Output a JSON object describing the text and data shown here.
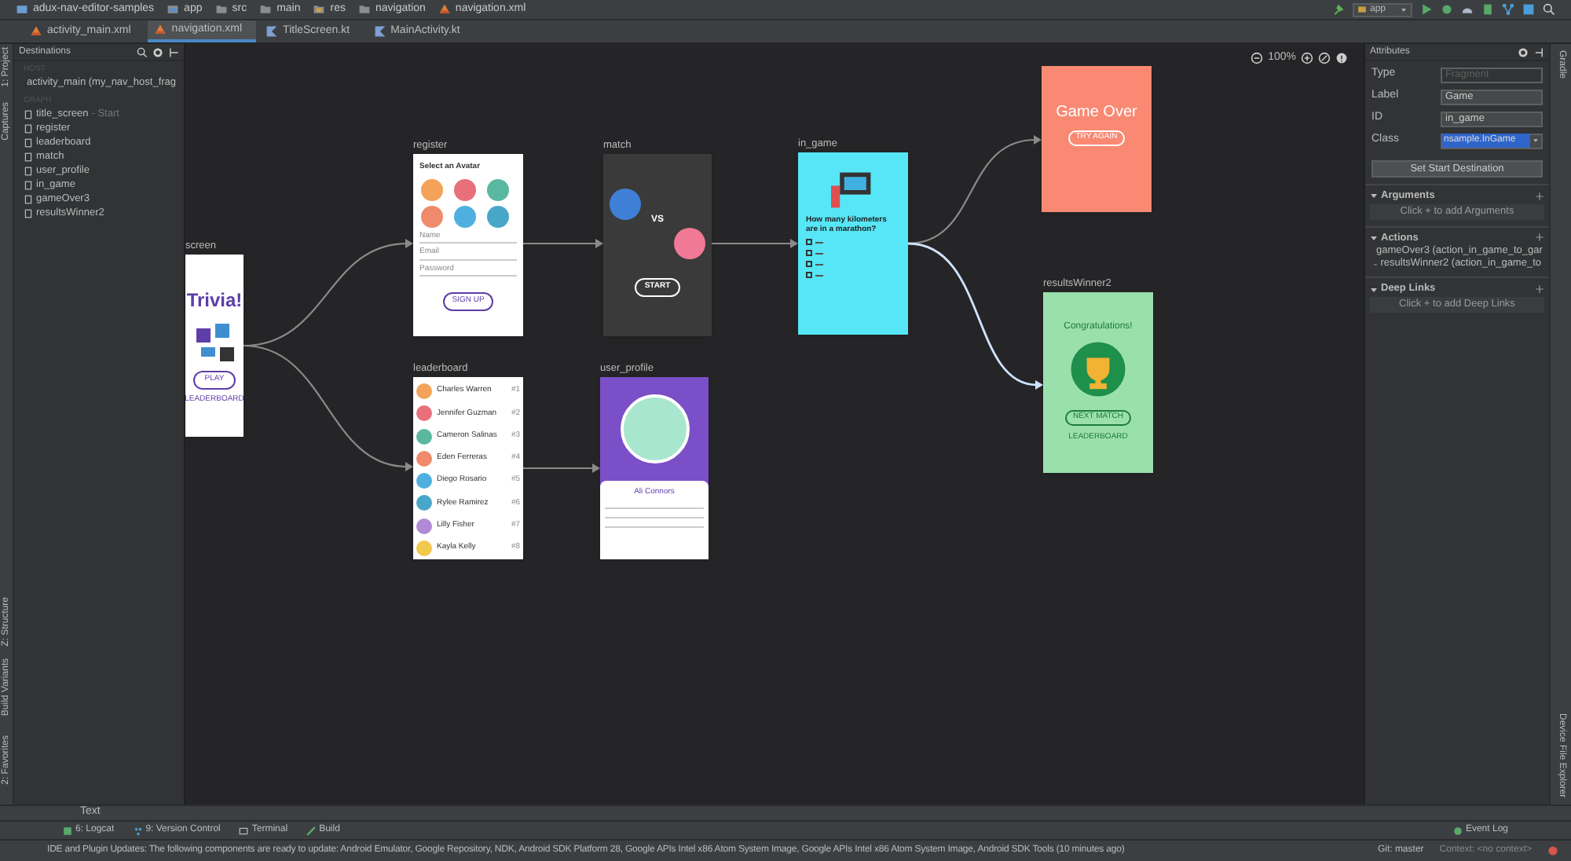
{
  "breadcrumbs": [
    {
      "kind": "project",
      "label": "adux-nav-editor-samples"
    },
    {
      "kind": "module",
      "label": "app"
    },
    {
      "kind": "folder",
      "label": "src"
    },
    {
      "kind": "folder",
      "label": "main"
    },
    {
      "kind": "res",
      "label": "res"
    },
    {
      "kind": "folder",
      "label": "navigation"
    },
    {
      "kind": "xml",
      "label": "navigation.xml"
    }
  ],
  "editor_tabs": [
    {
      "kind": "xml",
      "label": "activity_main.xml",
      "selected": false
    },
    {
      "kind": "xml",
      "label": "navigation.xml",
      "selected": true
    },
    {
      "kind": "kotlin",
      "label": "TitleScreen.kt",
      "selected": false
    },
    {
      "kind": "kotlin",
      "label": "MainActivity.kt",
      "selected": false
    }
  ],
  "run_config": "app",
  "left_strip": [
    "1: Project",
    "Captures",
    "Z: Structure",
    "Build Variants",
    "2: Favorites"
  ],
  "destinations": {
    "title": "Destinations",
    "host_heading": "HOST",
    "host": "activity_main (my_nav_host_frag",
    "graph_heading": "GRAPH",
    "items": [
      {
        "name": "title_screen",
        "note": "- Start"
      },
      {
        "name": "register"
      },
      {
        "name": "leaderboard"
      },
      {
        "name": "match"
      },
      {
        "name": "user_profile"
      },
      {
        "name": "in_game"
      },
      {
        "name": "gameOver3"
      },
      {
        "name": "resultsWinner2"
      }
    ]
  },
  "zoom": "100%",
  "screens": [
    {
      "kind": "title",
      "label": "screen",
      "title": "Trivia!",
      "button": "PLAY",
      "link": "LEADERBOARD"
    },
    {
      "kind": "register",
      "label": "register",
      "heading": "Select an Avatar",
      "fields": [
        "Name",
        "Email",
        "Password"
      ],
      "button": "SIGN UP"
    },
    {
      "kind": "match",
      "label": "match",
      "versus": "VS",
      "button": "START"
    },
    {
      "kind": "question",
      "label": "in_game",
      "question": "How many kilometers are in a marathon?",
      "options": [
        {
          "checked": false
        },
        {
          "checked": false
        },
        {
          "checked": false
        },
        {
          "checked": false
        }
      ]
    },
    {
      "kind": "game_over",
      "title": "Game Over",
      "button": "TRY AGAIN"
    },
    {
      "kind": "results",
      "label": "resultsWinner2",
      "title": "Congratulations!",
      "button": "NEXT MATCH",
      "link": "LEADERBOARD"
    },
    {
      "kind": "leaderboard",
      "label": "leaderboard",
      "rows": [
        {
          "name": "Charles Warren",
          "rank": "#1"
        },
        {
          "name": "Jennifer Guzman",
          "rank": "#2"
        },
        {
          "name": "Cameron Salinas",
          "rank": "#3"
        },
        {
          "name": "Eden Ferreras",
          "rank": "#4"
        },
        {
          "name": "Diego Rosario",
          "rank": "#5"
        },
        {
          "name": "Rylee Ramirez",
          "rank": "#6"
        },
        {
          "name": "Lilly Fisher",
          "rank": "#7"
        },
        {
          "name": "Kayla Kelly",
          "rank": "#8"
        }
      ]
    },
    {
      "kind": "profile",
      "label": "user_profile",
      "name": "Ali Connors"
    }
  ],
  "actions": [
    {
      "selected": false
    },
    {
      "selected": false
    },
    {
      "selected": false
    },
    {
      "selected": false
    },
    {
      "selected": false
    },
    {
      "selected": false
    },
    {
      "selected": true
    }
  ],
  "attributes": {
    "title": "Attributes",
    "fields": [
      {
        "label": "Type",
        "placeholder": "Fragment",
        "disabled": true
      },
      {
        "label": "Label",
        "value": "Game",
        "disabled": false
      },
      {
        "label": "ID",
        "value": "in_game",
        "disabled": false
      }
    ],
    "class_label": "Class",
    "class_value": "nsample.InGame",
    "start_button": "Set Start Destination",
    "sections": [
      {
        "title": "Arguments",
        "expanded": true,
        "hint": "Click + to add Arguments"
      },
      {
        "title": "Actions",
        "expanded": true,
        "items": [
          "gameOver3 (action_in_game_to_gar",
          "resultsWinner2 (action_in_game_to"
        ]
      },
      {
        "title": "Deep Links",
        "expanded": true,
        "hint": "Click + to add Deep Links"
      }
    ]
  },
  "right_strip": [
    "Gradle",
    "Device File Explorer"
  ],
  "mode_tabs": [
    {
      "label": "Text",
      "selected": false
    }
  ],
  "tool_windows": [
    {
      "kind": "logcat",
      "label": "6: Logcat"
    },
    {
      "kind": "vcs",
      "label": "9: Version Control"
    },
    {
      "kind": "terminal",
      "label": "Terminal"
    },
    {
      "kind": "build",
      "label": "Build"
    }
  ],
  "event_log": "Event Log",
  "status": {
    "message": "IDE and Plugin Updates: The following components are ready to update: Android Emulator, Google Repository, NDK, Android SDK Platform 28, Google APIs Intel x86 Atom System Image, Google APIs Intel x86 Atom System Image, Android SDK Tools (10 minutes ago)",
    "git": "Git: master",
    "context": "Context: <no context>"
  }
}
